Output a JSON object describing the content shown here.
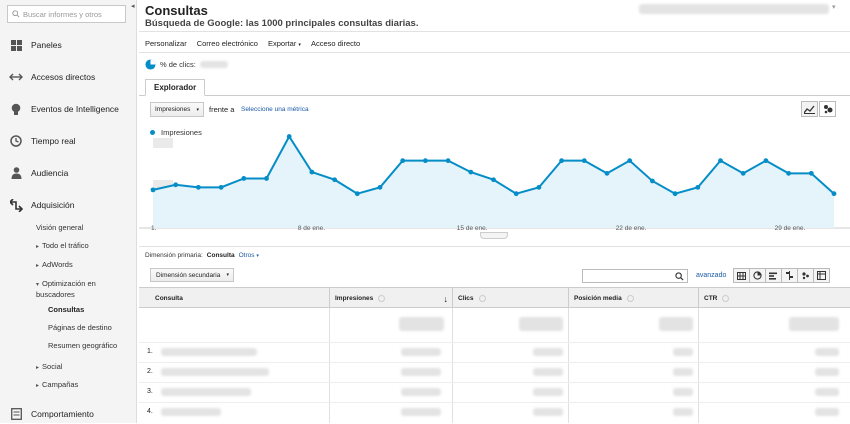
{
  "sidebar": {
    "search_placeholder": "Buscar informes y otros",
    "items": [
      {
        "label": "Paneles",
        "icon": "dashboard-grid-icon"
      },
      {
        "label": "Accesos directos",
        "icon": "shortcut-arrows-icon"
      },
      {
        "label": "Eventos de Intelligence",
        "icon": "lightbulb-icon"
      },
      {
        "label": "Tiempo real",
        "icon": "clock-icon"
      },
      {
        "label": "Audiencia",
        "icon": "person-icon"
      },
      {
        "label": "Adquisición",
        "icon": "acquisition-arrows-icon"
      },
      {
        "label": "Comportamiento",
        "icon": "behavior-page-icon"
      }
    ],
    "acquisition_sub": {
      "overview": "Visión general",
      "all_traffic": "Todo el tráfico",
      "adwords": "AdWords",
      "seo": "Optimización en buscadores",
      "queries": "Consultas",
      "landing_pages": "Páginas de destino",
      "geo_summary": "Resumen geográfico",
      "social": "Social",
      "campaigns": "Campañas"
    }
  },
  "header": {
    "title": "Consultas",
    "subtitle": "Búsqueda de Google: las 1000 principales consultas diarias."
  },
  "toolbar": {
    "customize": "Personalizar",
    "email": "Correo electrónico",
    "export": "Exportar",
    "shortcut": "Acceso directo"
  },
  "segment": {
    "label": "% de clics:"
  },
  "explorer": {
    "tab": "Explorador",
    "metric": "Impresiones",
    "vs": "frente a",
    "compare_link": "Seleccione una métrica"
  },
  "chart_data": {
    "type": "area",
    "series": [
      {
        "name": "Impresiones",
        "values": [
          30,
          34,
          32,
          32,
          39,
          39,
          72,
          44,
          38,
          27,
          32,
          53,
          53,
          53,
          44,
          38,
          27,
          32,
          53,
          53,
          43,
          53,
          37,
          27,
          32,
          53,
          43,
          53,
          43,
          43,
          27
        ]
      }
    ],
    "x_tick_labels": [
      "1.",
      "8 de ene.",
      "15 de ene.",
      "22 de ene.",
      "29 de ene."
    ],
    "color": "#058dc7",
    "ylim": [
      0,
      85
    ]
  },
  "table_controls": {
    "primary_dimension_label": "Dimensión primaria:",
    "primary_dimension_value": "Consulta",
    "other_link": "Otros",
    "secondary_dimension": "Dimensión secundaria",
    "advanced_link": "avanzado"
  },
  "table": {
    "columns": [
      "Consulta",
      "Impresiones",
      "Clics",
      "Posición media",
      "CTR"
    ],
    "row_numbers": [
      "1.",
      "2.",
      "3.",
      "4."
    ]
  }
}
